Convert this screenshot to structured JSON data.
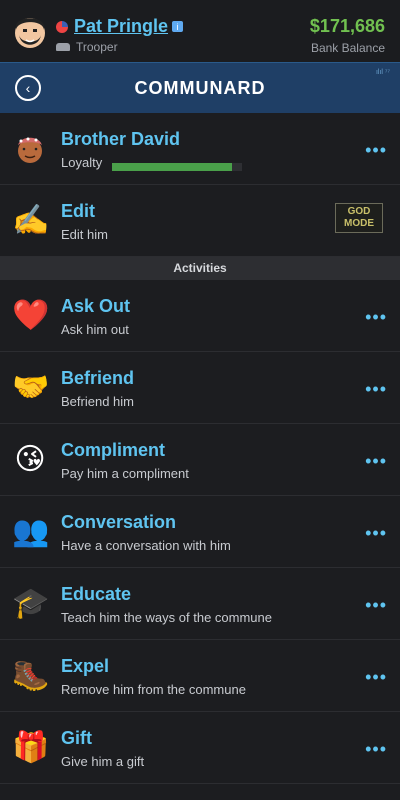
{
  "header": {
    "player_name": "Pat Pringle",
    "job": "Trooper",
    "money": "$171,686",
    "money_label": "Bank Balance"
  },
  "page": {
    "title": "COMMUNARD",
    "signal": "ılıl ⁷⁷"
  },
  "person": {
    "name": "Brother David",
    "loyalty_label": "Loyalty",
    "loyalty_value": 0.92
  },
  "edit": {
    "title": "Edit",
    "subtitle": "Edit him",
    "badge": "GOD MODE"
  },
  "section_title": "Activities",
  "activities": [
    {
      "title": "Ask Out",
      "subtitle": "Ask him out",
      "icon": "❤️"
    },
    {
      "title": "Befriend",
      "subtitle": "Befriend him",
      "icon": "🤝"
    },
    {
      "title": "Compliment",
      "subtitle": "Pay him a compliment",
      "icon": "😘"
    },
    {
      "title": "Conversation",
      "subtitle": "Have a conversation with him",
      "icon": "👥"
    },
    {
      "title": "Educate",
      "subtitle": "Teach him the ways of the commune",
      "icon": "🎓"
    },
    {
      "title": "Expel",
      "subtitle": "Remove him from the commune",
      "icon": "🥾"
    },
    {
      "title": "Gift",
      "subtitle": "Give him a gift",
      "icon": "🎁"
    }
  ],
  "ui": {
    "more": "•••",
    "back": "‹"
  }
}
